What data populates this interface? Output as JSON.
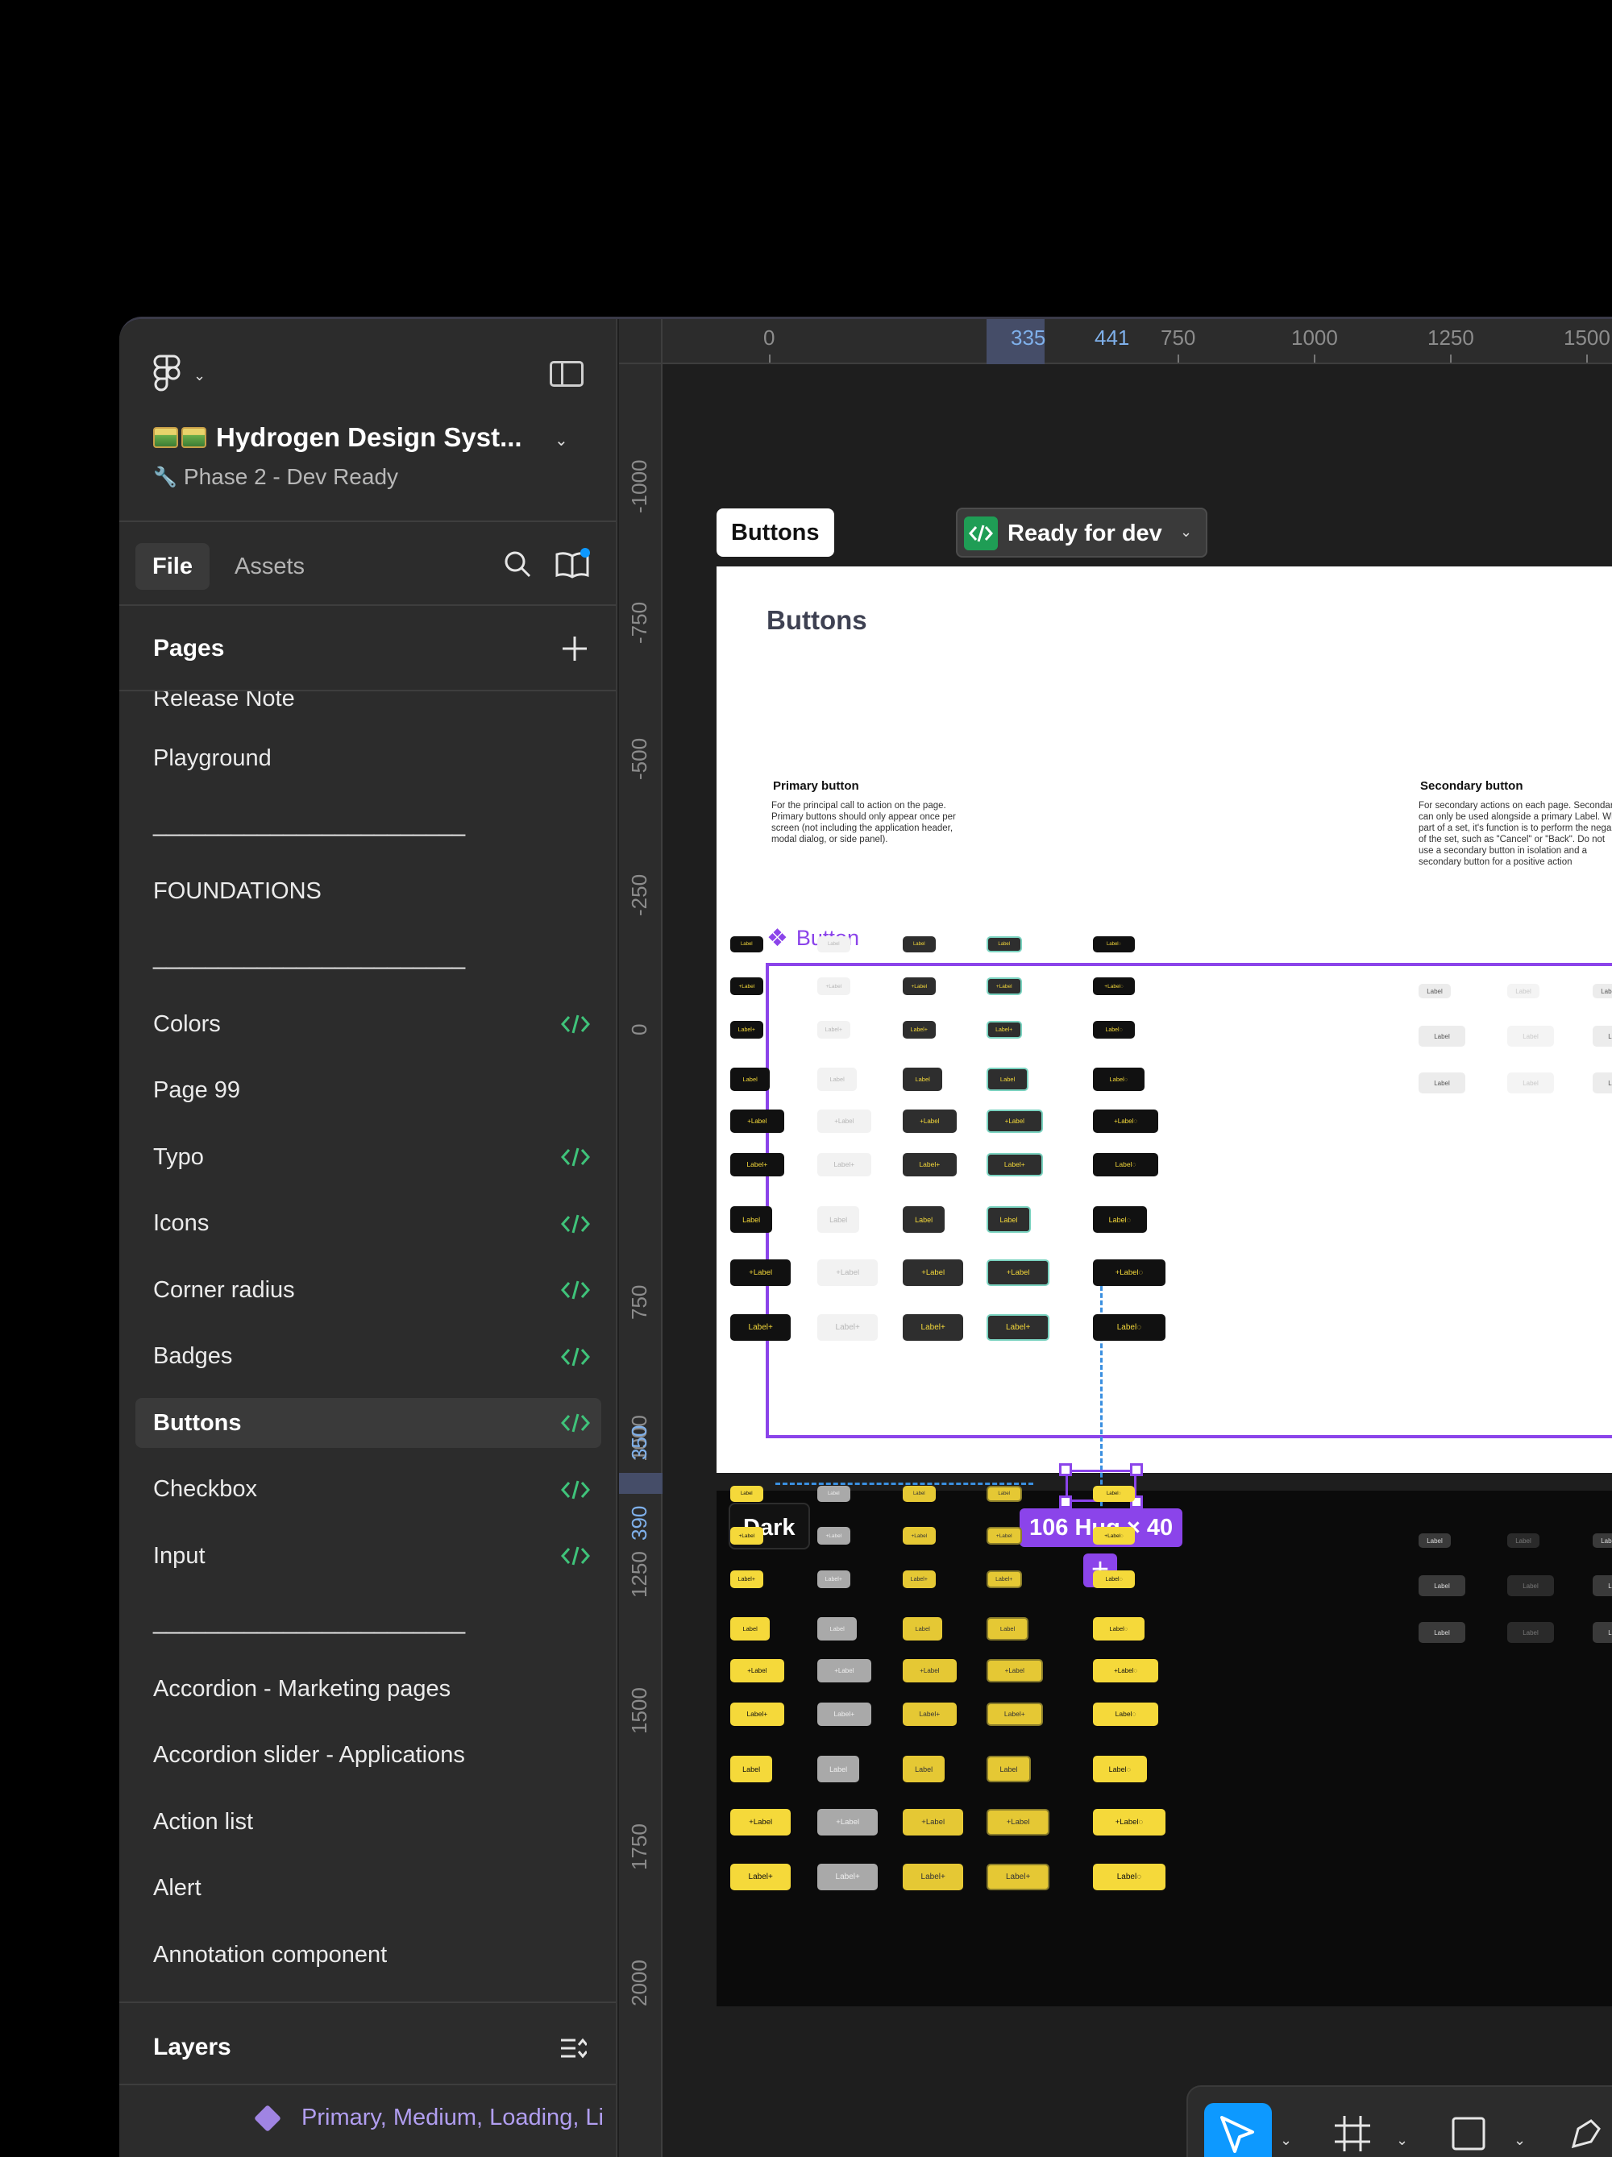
{
  "file": {
    "title": "Hydrogen Design Syst...",
    "subtitle": "Phase 2 - Dev Ready"
  },
  "tabs": [
    {
      "label": "File",
      "active": true
    },
    {
      "label": "Assets",
      "active": false
    }
  ],
  "pages_panel": {
    "title": "Pages",
    "partial_item": "Release Note",
    "items": [
      {
        "label": "Playground",
        "dev": false,
        "selected": false
      },
      {
        "label": "________________________",
        "dev": false,
        "selected": false
      },
      {
        "label": "FOUNDATIONS",
        "dev": false,
        "selected": false
      },
      {
        "label": "________________________",
        "dev": false,
        "selected": false
      },
      {
        "label": "Colors",
        "dev": true,
        "selected": false
      },
      {
        "label": "Page 99",
        "dev": false,
        "selected": false
      },
      {
        "label": "Typo",
        "dev": true,
        "selected": false
      },
      {
        "label": "Icons",
        "dev": true,
        "selected": false
      },
      {
        "label": "Corner radius",
        "dev": true,
        "selected": false
      },
      {
        "label": "Badges",
        "dev": true,
        "selected": false
      },
      {
        "label": "Buttons",
        "dev": true,
        "selected": true
      },
      {
        "label": "Checkbox",
        "dev": true,
        "selected": false
      },
      {
        "label": "Input",
        "dev": true,
        "selected": false
      },
      {
        "label": "________________________",
        "dev": false,
        "selected": false
      },
      {
        "label": "Accordion - Marketing pages",
        "dev": false,
        "selected": false
      },
      {
        "label": "Accordion slider  - Applications",
        "dev": false,
        "selected": false
      },
      {
        "label": "Action list",
        "dev": false,
        "selected": false
      },
      {
        "label": "Alert",
        "dev": false,
        "selected": false
      },
      {
        "label": "Annotation component",
        "dev": false,
        "selected": false
      }
    ]
  },
  "layers_panel": {
    "title": "Layers",
    "selected_layer": "Primary, Medium, Loading, Li"
  },
  "ruler_top": {
    "ticks": [
      "0",
      "750",
      "1000",
      "1250",
      "1500"
    ],
    "selection_start": "335",
    "selection_end": "441"
  },
  "ruler_left": {
    "ticks": [
      "-1000",
      "-750",
      "-500",
      "-250",
      "0",
      "750",
      "1000",
      "1250",
      "1500",
      "1750",
      "2000"
    ],
    "selection_start": "350",
    "selection_end": "390"
  },
  "canvas": {
    "frame_name": "Buttons",
    "status": "Ready for dev",
    "page_heading": "Buttons",
    "primary_heading": "Primary button",
    "primary_desc": "For the principal call to action on the page. Primary buttons should only appear once per screen (not including the application header, modal dialog, or side panel).",
    "secondary_heading": "Secondary button",
    "secondary_desc": "For secondary actions on each page. Secondar can only be used alongside a primary Label. Wh part of a set, it's function is to perform the nega of the set, such as \"Cancel\" or \"Back\". Do not use a secondary button in isolation and a secondary button for a positive action",
    "component_name": "Button",
    "dark_frame_name": "Dark",
    "button_label": "Label",
    "selection_size": "106 Hug × 40"
  },
  "colors": {
    "accent": "#8b44ea",
    "selection_blue": "#0d99ff",
    "dev_green": "#1f9d55",
    "button_yellow": "#f5d93a"
  }
}
